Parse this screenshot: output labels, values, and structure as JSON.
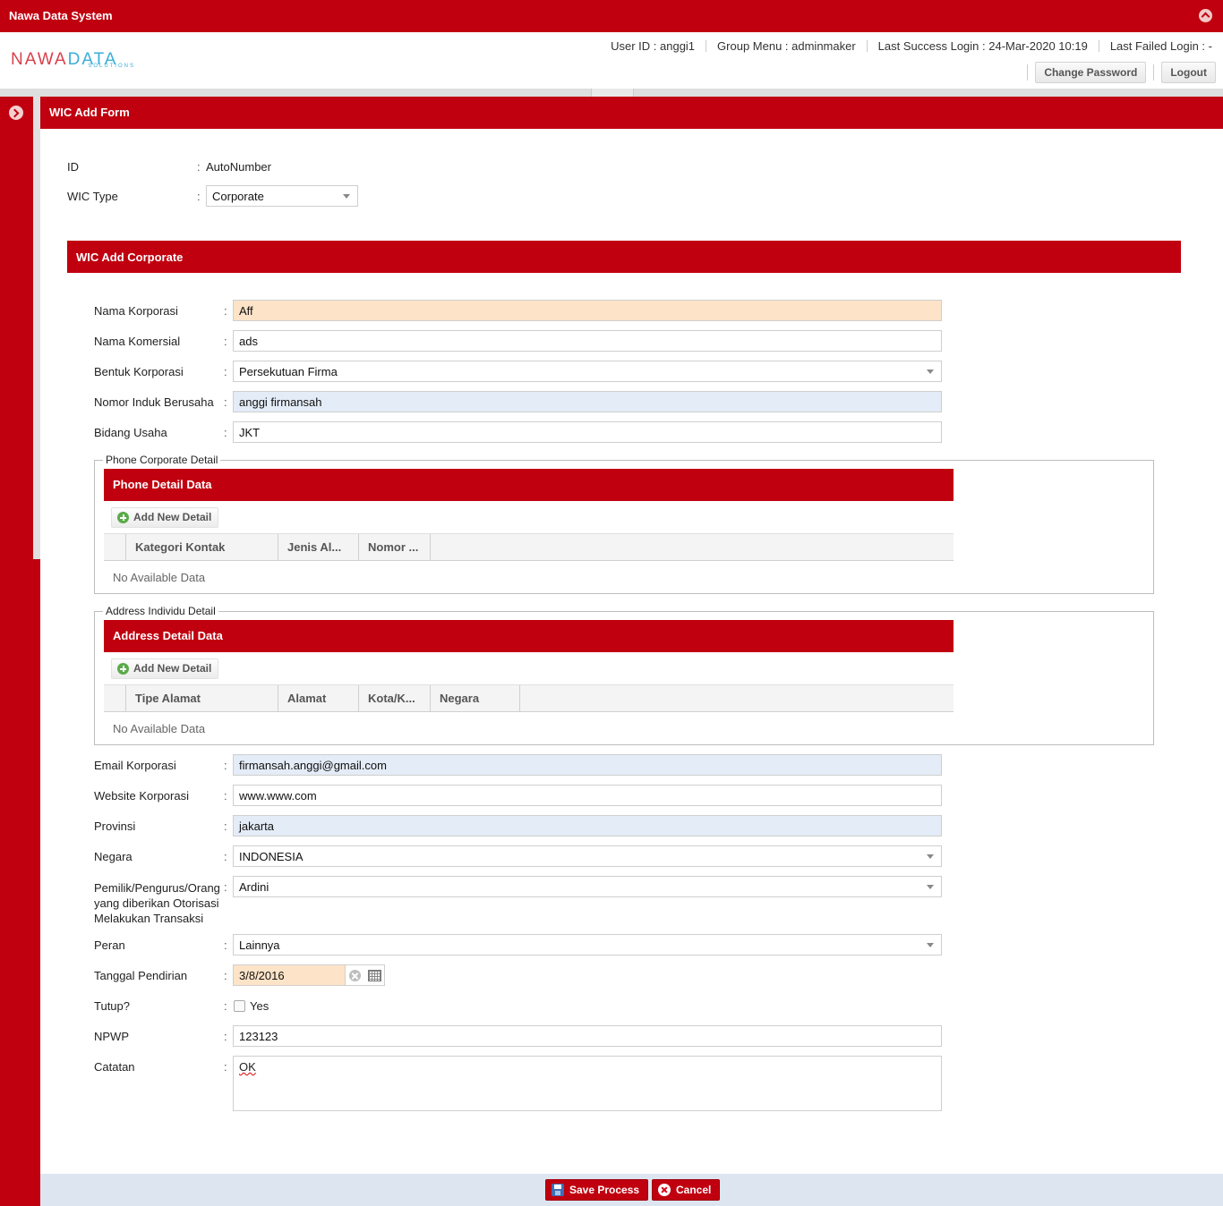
{
  "app": {
    "title": "Nawa Data System"
  },
  "logo": {
    "main_a": "NAWA",
    "main_b": "DATA",
    "sub": "SOLUTIONS"
  },
  "user": {
    "user_id": "User ID : anggi1",
    "group_menu": "Group Menu : adminmaker",
    "last_success": "Last Success Login : 24-Mar-2020 10:19",
    "last_failed": "Last Failed Login : -",
    "change_password": "Change Password",
    "logout": "Logout"
  },
  "form": {
    "title": "WIC Add Form",
    "id_label": "ID",
    "id_value": "AutoNumber",
    "wic_type_label": "WIC Type",
    "wic_type_value": "Corporate"
  },
  "corporate": {
    "title": "WIC Add Corporate",
    "nama_korporasi_label": "Nama Korporasi",
    "nama_korporasi": "Aff",
    "nama_komersial_label": "Nama Komersial",
    "nama_komersial": "ads",
    "bentuk_korporasi_label": "Bentuk Korporasi",
    "bentuk_korporasi": "Persekutuan Firma",
    "nomor_induk_label": "Nomor Induk Berusaha",
    "nomor_induk": "anggi firmansah",
    "bidang_usaha_label": "Bidang Usaha",
    "bidang_usaha": "JKT",
    "email_label": "Email Korporasi",
    "email": "firmansah.anggi@gmail.com",
    "website_label": "Website Korporasi",
    "website": "www.www.com",
    "provinsi_label": "Provinsi",
    "provinsi": "jakarta",
    "negara_label": "Negara",
    "negara": "INDONESIA",
    "pemilik_label_1": "Pemilik/Pengurus/Orang",
    "pemilik_label_2": "yang diberikan Otorisasi",
    "pemilik_label_3": "Melakukan Transaksi",
    "pemilik": "Ardini",
    "peran_label": "Peran",
    "peran": "Lainnya",
    "tanggal_label": "Tanggal Pendirian",
    "tanggal": "3/8/2016",
    "tutup_label": "Tutup?",
    "tutup_option": "Yes",
    "npwp_label": "NPWP",
    "npwp": "123123",
    "catatan_label": "Catatan",
    "catatan": "OK"
  },
  "phone_section": {
    "legend": "Phone Corporate Detail",
    "grid_title": "Phone Detail Data",
    "add_button": "Add New Detail",
    "columns": [
      "Kategori Kontak",
      "Jenis Al...",
      "Nomor ..."
    ],
    "empty": "No Available Data"
  },
  "address_section": {
    "legend": "Address Individu Detail",
    "grid_title": "Address Detail Data",
    "add_button": "Add New Detail",
    "columns": [
      "Tipe Alamat",
      "Alamat",
      "Kota/K...",
      "Negara"
    ],
    "empty": "No Available Data"
  },
  "footer": {
    "save": "Save Process",
    "cancel": "Cancel"
  },
  "colors": {
    "brand_red": "#c0000f",
    "required_bg": "#fde4c8",
    "readonly_bg": "#e4ecf7"
  },
  "icons": [
    "collapse-up-icon",
    "expand-west-icon",
    "add-icon",
    "clear-icon",
    "calendar-icon",
    "save-icon",
    "cancel-icon",
    "chevron-down-icon"
  ]
}
